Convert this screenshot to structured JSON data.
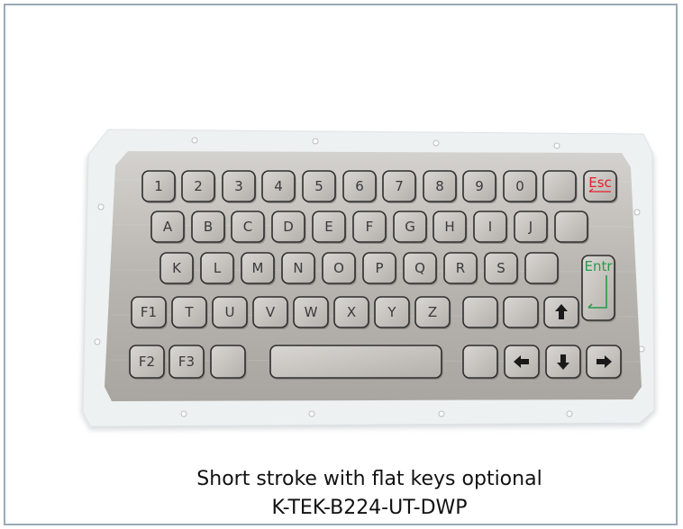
{
  "colors": {
    "frame_border": "#9aa9b8",
    "bezel": "#ecefef",
    "steel_plate": "#b9b6b1",
    "key_outline": "#2e2e2e",
    "escape_label": "#e0202a",
    "enter_label": "#2a9a4a"
  },
  "keyboard": {
    "row1": [
      "1",
      "2",
      "3",
      "4",
      "5",
      "6",
      "7",
      "8",
      "9",
      "0",
      "",
      "Esc"
    ],
    "row2": [
      "A",
      "B",
      "C",
      "D",
      "E",
      "F",
      "G",
      "H",
      "I",
      "J",
      ""
    ],
    "row3": [
      "K",
      "L",
      "M",
      "N",
      "O",
      "P",
      "Q",
      "R",
      "S",
      "",
      "Entr"
    ],
    "row4": [
      "F1",
      "T",
      "U",
      "V",
      "W",
      "X",
      "Y",
      "Z",
      "",
      "",
      "arrow-up-icon"
    ],
    "row5": [
      "F2",
      "F3",
      "",
      "space-bar",
      "",
      "arrow-left-icon",
      "arrow-down-icon",
      "arrow-right-icon"
    ]
  },
  "caption": {
    "line1": "Short stroke with flat keys optional",
    "line2": "K-TEK-B224-UT-DWP"
  }
}
